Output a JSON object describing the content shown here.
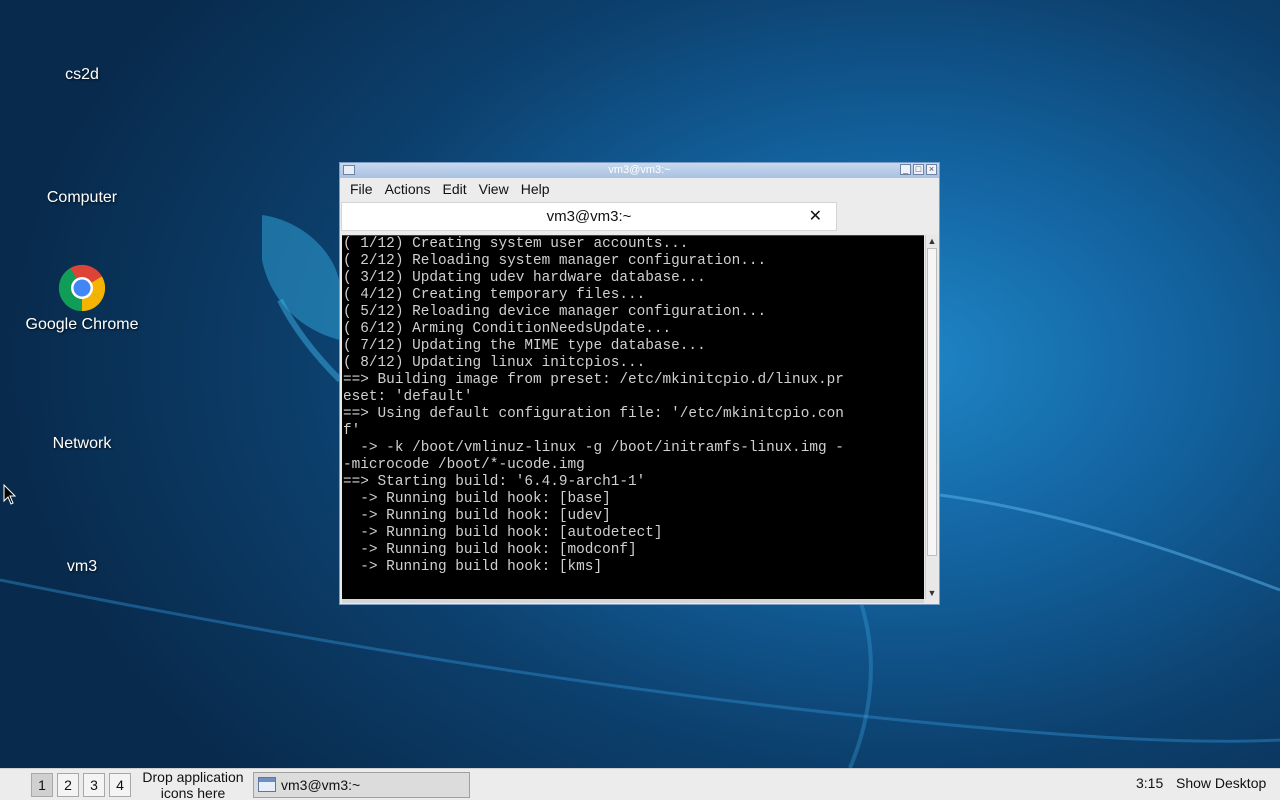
{
  "desktop": {
    "icons": [
      {
        "label": "cs2d",
        "icon": "cs2d-icon"
      },
      {
        "label": "Computer",
        "icon": "computer-icon"
      },
      {
        "label": "Google Chrome",
        "icon": "chrome-icon"
      },
      {
        "label": "Network",
        "icon": "network-icon"
      },
      {
        "label": "vm3",
        "icon": "folder-icon"
      }
    ]
  },
  "terminal": {
    "window_title": "vm3@vm3:~",
    "menu": [
      "File",
      "Actions",
      "Edit",
      "View",
      "Help"
    ],
    "tab_title": "vm3@vm3:~",
    "tab_close_glyph": "✕",
    "lines": [
      "( 1/12) Creating system user accounts...",
      "( 2/12) Reloading system manager configuration...",
      "( 3/12) Updating udev hardware database...",
      "( 4/12) Creating temporary files...",
      "( 5/12) Reloading device manager configuration...",
      "( 6/12) Arming ConditionNeedsUpdate...",
      "( 7/12) Updating the MIME type database...",
      "( 8/12) Updating linux initcpios...",
      "==> Building image from preset: /etc/mkinitcpio.d/linux.pr",
      "eset: 'default'",
      "==> Using default configuration file: '/etc/mkinitcpio.con",
      "f'",
      "  -> -k /boot/vmlinuz-linux -g /boot/initramfs-linux.img -",
      "-microcode /boot/*-ucode.img",
      "==> Starting build: '6.4.9-arch1-1'",
      "  -> Running build hook: [base]",
      "  -> Running build hook: [udev]",
      "  -> Running build hook: [autodetect]",
      "  -> Running build hook: [modconf]",
      "  -> Running build hook: [kms]"
    ]
  },
  "taskbar": {
    "workspaces": [
      "1",
      "2",
      "3",
      "4"
    ],
    "active_workspace": "1",
    "drop_hint_line1": "Drop application",
    "drop_hint_line2": "icons here",
    "task_label": "vm3@vm3:~",
    "clock": "3:15",
    "show_desktop": "Show Desktop"
  },
  "colors": {
    "terminal_bg": "#000000",
    "terminal_fg": "#d0d0d0",
    "desktop_accent": "#1f86c7"
  }
}
